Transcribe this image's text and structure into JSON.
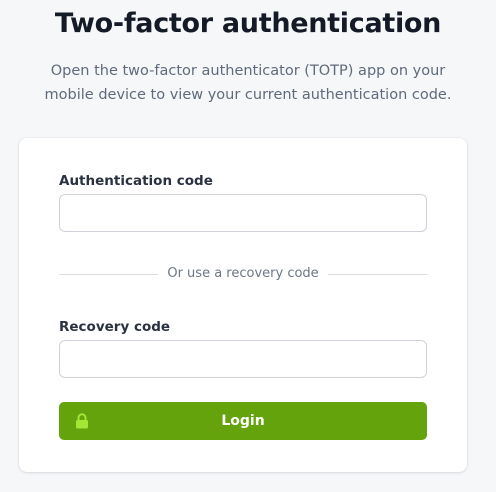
{
  "header": {
    "title": "Two-factor authentication",
    "subtitle": "Open the two-factor authenticator (TOTP) app on your mobile device to view your current authentication code."
  },
  "form": {
    "auth_code_label": "Authentication code",
    "auth_code_value": "",
    "divider_text": "Or use a recovery code",
    "recovery_code_label": "Recovery code",
    "recovery_code_value": "",
    "login_label": "Login",
    "login_icon": "lock-icon"
  },
  "colors": {
    "accent": "#65a30d",
    "background": "#f6f7f9",
    "card": "#ffffff",
    "lock_icon": "#a3e635"
  }
}
